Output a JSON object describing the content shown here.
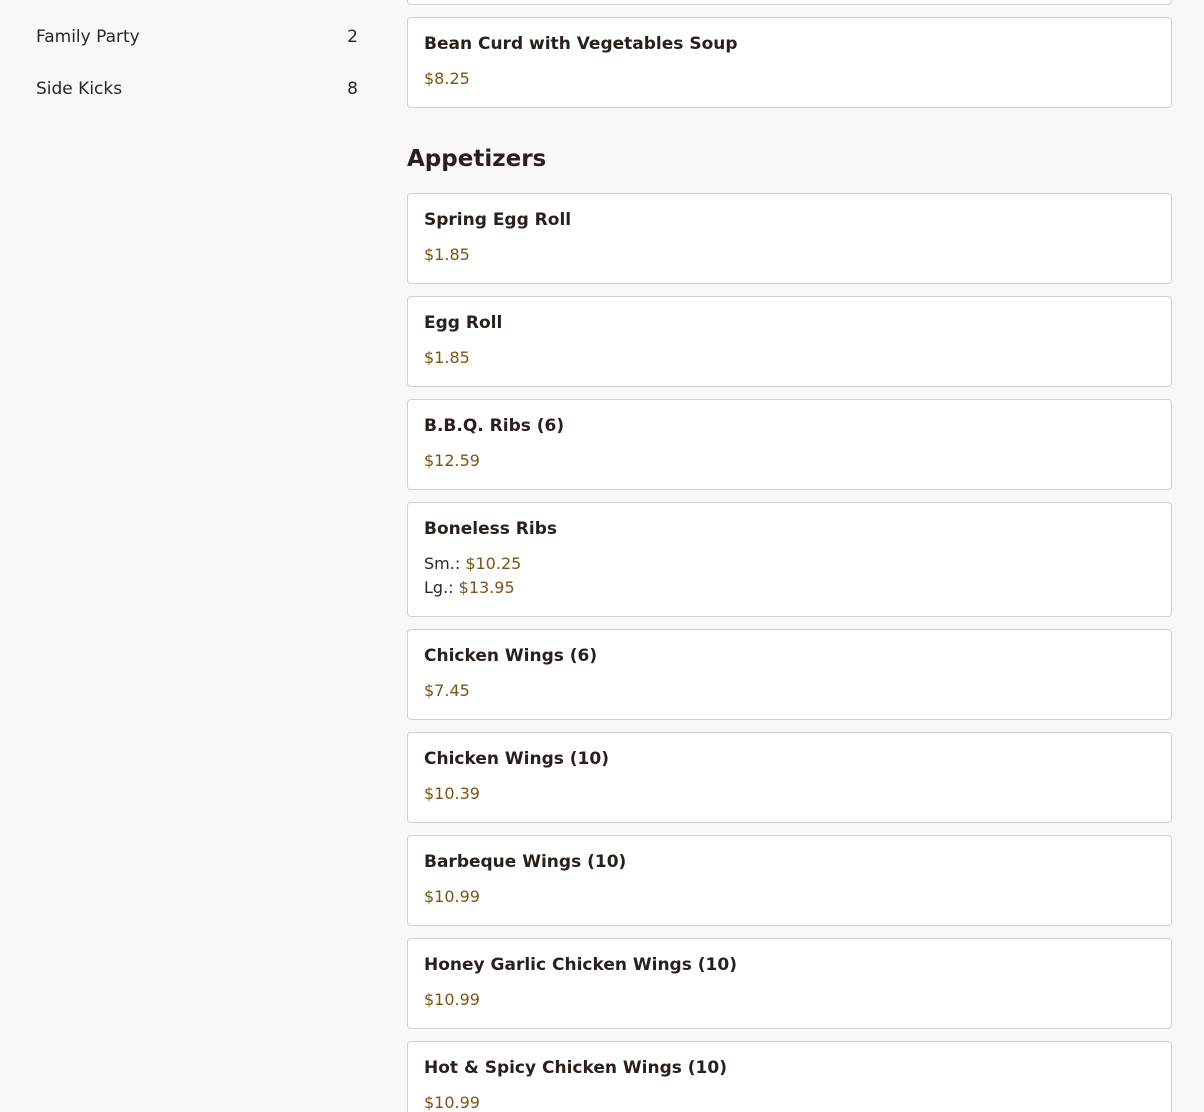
{
  "sidebar": {
    "categories": [
      {
        "label": "Family Party",
        "count": "2"
      },
      {
        "label": "Side Kicks",
        "count": "8"
      }
    ]
  },
  "main": {
    "prev_item": {
      "name": "Bean Curd with Vegetables Soup",
      "price": "$8.25"
    },
    "section_title": "Appetizers",
    "items": [
      {
        "name": "Spring Egg Roll",
        "price": "$1.85"
      },
      {
        "name": "Egg Roll",
        "price": "$1.85"
      },
      {
        "name": "B.B.Q. Ribs (6)",
        "price": "$12.59"
      },
      {
        "name": "Boneless Ribs",
        "sizes": [
          {
            "label": "Sm.:",
            "price": "$10.25"
          },
          {
            "label": "Lg.:",
            "price": "$13.95"
          }
        ]
      },
      {
        "name": "Chicken Wings (6)",
        "price": "$7.45"
      },
      {
        "name": "Chicken Wings (10)",
        "price": "$10.39"
      },
      {
        "name": "Barbeque Wings (10)",
        "price": "$10.99"
      },
      {
        "name": "Honey Garlic Chicken Wings (10)",
        "price": "$10.99"
      },
      {
        "name": "Hot & Spicy Chicken Wings (10)",
        "price": "$10.99"
      }
    ]
  }
}
